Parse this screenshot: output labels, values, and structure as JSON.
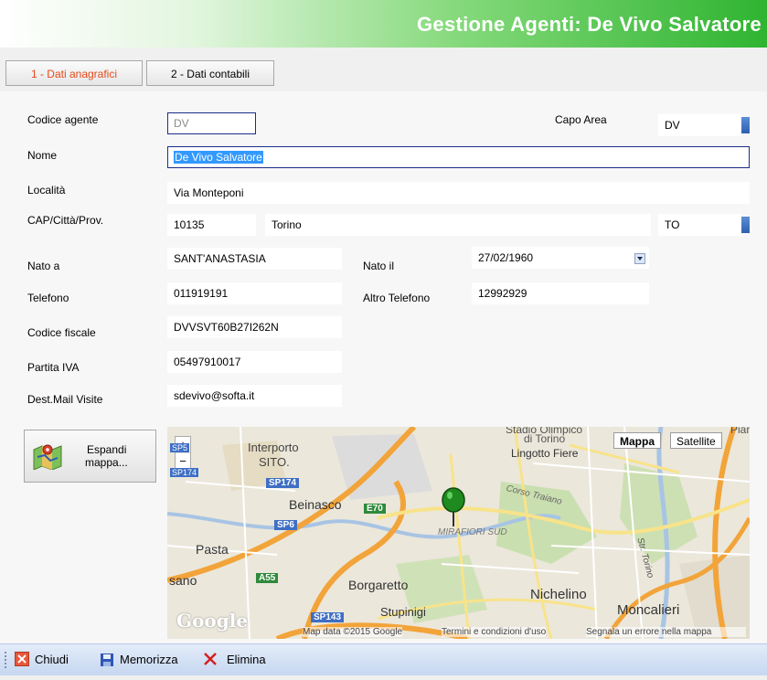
{
  "header": {
    "title": "Gestione Agenti: De Vivo Salvatore"
  },
  "tabs": [
    {
      "label": "1 - Dati anagrafici",
      "active": true
    },
    {
      "label": "2 - Dati contabili",
      "active": false
    }
  ],
  "form": {
    "codice_agente": {
      "label": "Codice agente",
      "value": "DV"
    },
    "capo_area": {
      "label": "Capo Area",
      "value": "DV"
    },
    "nome": {
      "label": "Nome",
      "value": "De Vivo Salvatore"
    },
    "localita": {
      "label": "Località",
      "value": "Via Monteponi"
    },
    "cap_citta_prov": {
      "label": "CAP/Città/Prov.",
      "cap": "10135",
      "citta": "Torino",
      "prov": "TO"
    },
    "nato_a": {
      "label": "Nato a",
      "value": "SANT'ANASTASIA"
    },
    "nato_il": {
      "label": "Nato il",
      "value": "27/02/1960"
    },
    "telefono": {
      "label": "Telefono",
      "value": "011919191"
    },
    "altro_telefono": {
      "label": "Altro Telefono",
      "value": "12992929"
    },
    "codice_fiscale": {
      "label": "Codice fiscale",
      "value": "DVVSVT60B27I262N"
    },
    "partita_iva": {
      "label": "Partita IVA",
      "value": "05497910017"
    },
    "dest_mail": {
      "label": "Dest.Mail Visite",
      "value": "sdevivo@softa.it"
    }
  },
  "expand_button": {
    "line1": "Espandi",
    "line2": "mappa..."
  },
  "map": {
    "type_buttons": [
      "Mappa",
      "Satellite"
    ],
    "zoom_in": "+",
    "zoom_out": "−",
    "places": {
      "interporto": "Interporto",
      "sito": "SITO.",
      "stadio": "Stadio Olimpico",
      "di_torino": "di Torino",
      "lingotto": "Lingotto Fiere",
      "corso_traiano": "Corso Traiano",
      "beinasco": "Beinasco",
      "mirafiori": "MIRAFIORI SUD",
      "pasta": "Pasta",
      "sano": "sano",
      "borgaretto": "Borgaretto",
      "nichelino": "Nichelino",
      "stupinigi": "Stupinigi",
      "moncalieri": "Moncalieri",
      "str_torino": "Str. Torino",
      "pian": "Pian"
    },
    "roads": {
      "sp174": "SP174",
      "sp6": "SP6",
      "e70": "E70",
      "a55": "A55",
      "sp143": "SP143",
      "sp5": "SP5",
      "s174": "SP174"
    },
    "logo": "Google",
    "attribution": "Map data ©2015 Google",
    "terms": "Termini e condizioni d'uso",
    "report": "Segnala un errore nella mappa"
  },
  "toolbar": {
    "close": "Chiudi",
    "save": "Memorizza",
    "delete": "Elimina"
  },
  "colors": {
    "accent_tab": "#e64a19",
    "header_green": "#2fb431",
    "field_border": "#1c2d8a",
    "pin": "#1f8a1f"
  }
}
